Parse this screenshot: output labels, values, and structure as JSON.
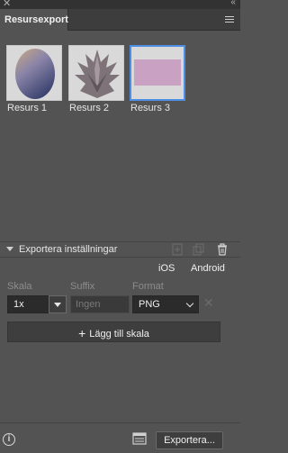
{
  "window": {
    "close_glyph": "✕",
    "collapse_glyph": "‹‹"
  },
  "panel": {
    "tab_title": "Resursexport",
    "menu_icon": "hamburger-menu-icon"
  },
  "assets": [
    {
      "label": "Resurs 1",
      "selected": false,
      "icon": "oval-gradient-thumbnail"
    },
    {
      "label": "Resurs 2",
      "selected": false,
      "icon": "leaf-shape-thumbnail"
    },
    {
      "label": "Resurs 3",
      "selected": true,
      "icon": "pink-rectangle-thumbnail",
      "fill": "#c9a2c3"
    }
  ],
  "export_settings": {
    "title": "Exportera inställningar",
    "header_icons": [
      "add-icon",
      "duplicate-icon",
      "trash-icon"
    ],
    "platforms": [
      "iOS",
      "Android"
    ],
    "columns": {
      "scale": "Skala",
      "suffix": "Suffix",
      "format": "Format"
    },
    "row": {
      "scale_value": "1x",
      "suffix_placeholder": "Ingen",
      "format_value": "PNG"
    },
    "add_scale_label": "Lägg till skala",
    "add_scale_glyph": "+"
  },
  "footer": {
    "info_glyph": "i",
    "export_button_label": "Exportera..."
  },
  "colors": {
    "panel_bg": "#535353",
    "selection": "#4c8fe5"
  }
}
